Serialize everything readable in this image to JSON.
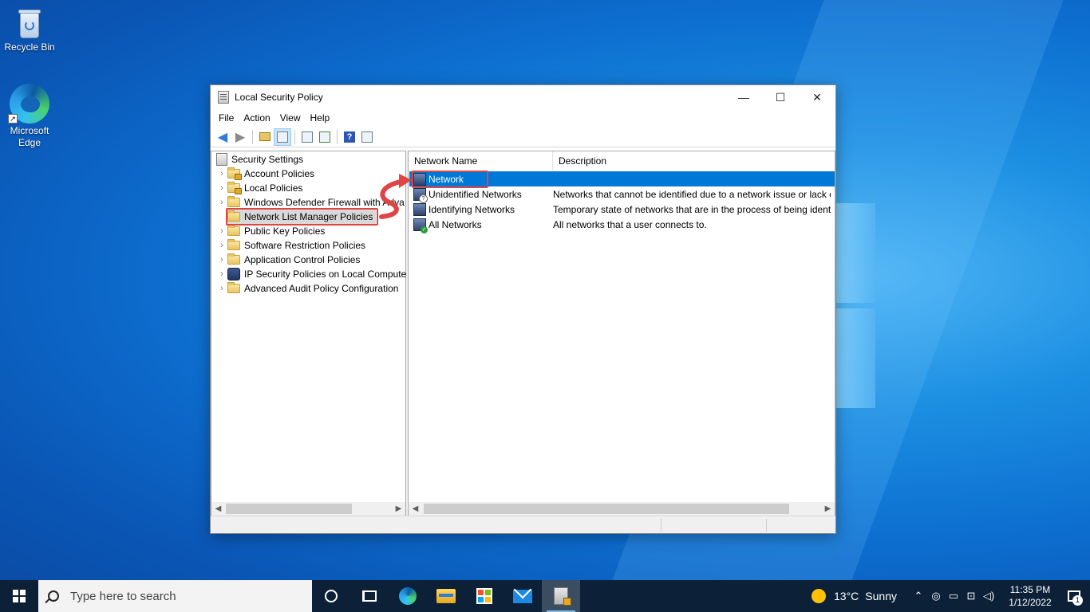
{
  "desktop": {
    "icons": [
      {
        "label": "Recycle Bin"
      },
      {
        "label": "Microsoft Edge"
      }
    ]
  },
  "window": {
    "title": "Local Security Policy",
    "controls": {
      "minimize": "—",
      "maximize": "☐",
      "close": "✕"
    },
    "menu": [
      "File",
      "Action",
      "View",
      "Help"
    ],
    "tree": {
      "root": "Security Settings",
      "items": [
        {
          "label": "Account Policies",
          "icon": "folder-lock-icon"
        },
        {
          "label": "Local Policies",
          "icon": "folder-lock-icon"
        },
        {
          "label": "Windows Defender Firewall with Adva",
          "icon": "folder-icon"
        },
        {
          "label": "Network List Manager Policies",
          "icon": "folder-icon",
          "selected": true
        },
        {
          "label": "Public Key Policies",
          "icon": "folder-icon"
        },
        {
          "label": "Software Restriction Policies",
          "icon": "folder-icon"
        },
        {
          "label": "Application Control Policies",
          "icon": "folder-icon"
        },
        {
          "label": "IP Security Policies on Local Compute",
          "icon": "ip-security-icon"
        },
        {
          "label": "Advanced Audit Policy Configuration",
          "icon": "folder-icon"
        }
      ]
    },
    "list": {
      "columns": [
        "Network Name",
        "Description"
      ],
      "rows": [
        {
          "name": "Network",
          "description": "",
          "selected": true
        },
        {
          "name": "Unidentified Networks",
          "description": "Networks that cannot be identified due to a network issue or lack o"
        },
        {
          "name": "Identifying Networks",
          "description": "Temporary state of networks that are in the process of being identi"
        },
        {
          "name": "All Networks",
          "description": "All networks that a user connects to."
        }
      ]
    },
    "highlight_color": "#e04545"
  },
  "taskbar": {
    "search_placeholder": "Type here to search",
    "weather": {
      "temp": "13°C",
      "condition": "Sunny"
    },
    "clock": {
      "time": "11:35 PM",
      "date": "1/12/2022"
    },
    "notification_count": "1"
  }
}
